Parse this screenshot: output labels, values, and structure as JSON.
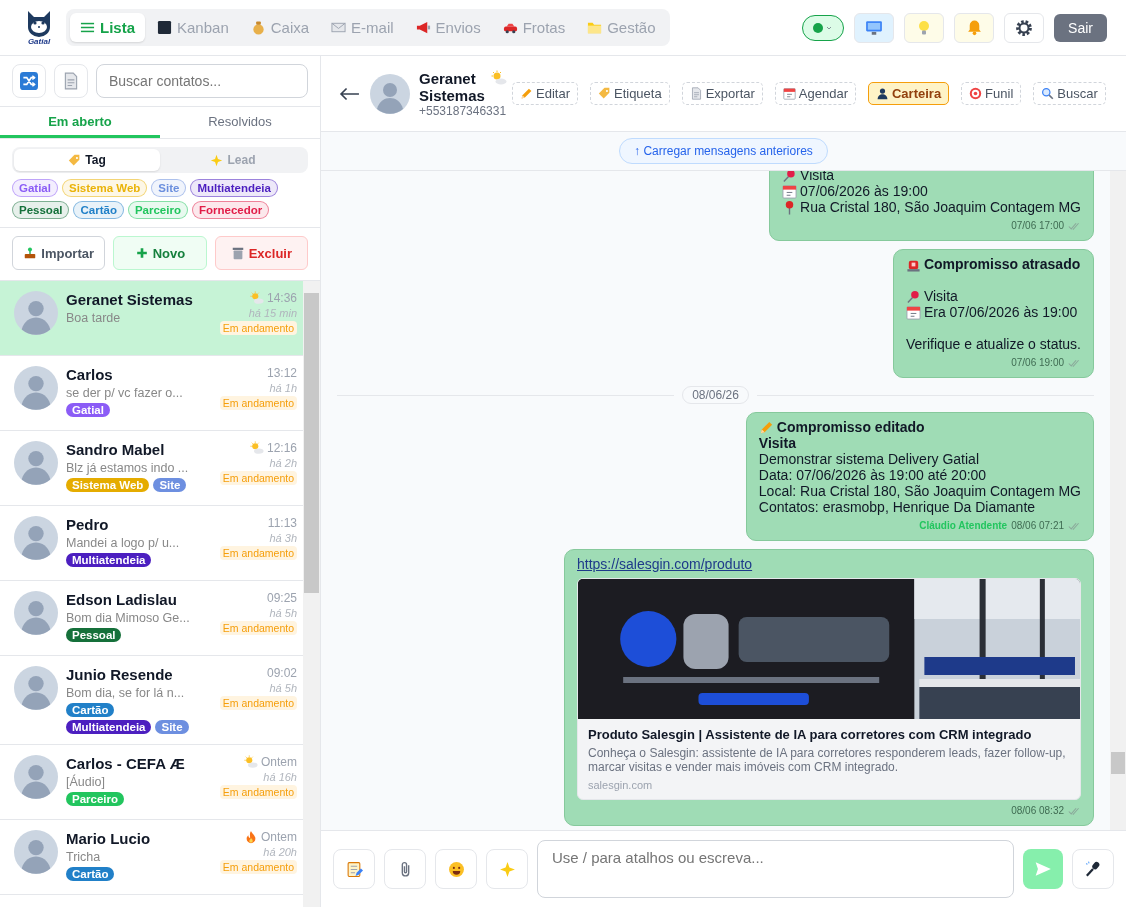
{
  "topbar": {
    "brand": "Gatial",
    "nav": [
      {
        "label": "Lista",
        "selected": true
      },
      {
        "label": "Kanban",
        "selected": false
      },
      {
        "label": "Caixa",
        "selected": false
      },
      {
        "label": "E-mail",
        "selected": false
      },
      {
        "label": "Envios",
        "selected": false
      },
      {
        "label": "Frotas",
        "selected": false
      },
      {
        "label": "Gestão",
        "selected": false
      }
    ],
    "online": true,
    "logout": "Sair"
  },
  "sidebar": {
    "search": {
      "placeholder": "Buscar contatos..."
    },
    "tabs": [
      {
        "label": "Em aberto",
        "selected": true
      },
      {
        "label": "Resolvidos",
        "selected": false
      }
    ],
    "filter_modes": [
      {
        "label": "Tag",
        "selected": true
      },
      {
        "label": "Lead",
        "selected": false
      }
    ],
    "filter_tags": [
      {
        "label": "Gatial",
        "color": "#8b5cf6"
      },
      {
        "label": "Sistema Web",
        "color": "#eab308"
      },
      {
        "label": "Site",
        "color": "#6b8fde"
      },
      {
        "label": "Multiatendeia",
        "color": "#4c1fc0"
      },
      {
        "label": "Pessoal",
        "color": "#15703a"
      },
      {
        "label": "Cartão",
        "color": "#2180c8"
      },
      {
        "label": "Parceiro",
        "color": "#22c55e"
      },
      {
        "label": "Fornecedor",
        "color": "#e11d48"
      }
    ],
    "actions": [
      {
        "label": "Importar",
        "kind": "import"
      },
      {
        "label": "Novo",
        "kind": "new"
      },
      {
        "label": "Excluir",
        "kind": "delete"
      }
    ],
    "contacts": [
      {
        "name": "Geranet Sistemas",
        "preview": "Boa tarde",
        "time": "14:36",
        "ago": "há 15 min",
        "status": "Em andamento",
        "kind": "warm",
        "selected": true
      },
      {
        "name": "Carlos",
        "preview": "se der p/ vc fazer o...",
        "time": "13:12",
        "ago": "há 1h",
        "status": "Em andamento",
        "selected": false,
        "tags": [
          {
            "label": "Gatial",
            "color": "#8b5cf6"
          }
        ]
      },
      {
        "name": "Sandro Mabel",
        "preview": "Blz já estamos indo ...",
        "time": "12:16",
        "ago": "há 2h",
        "status": "Em andamento",
        "kind": "warm",
        "selected": false,
        "tags": [
          {
            "label": "Sistema Web",
            "color": "#e5ac00"
          },
          {
            "label": "Site",
            "color": "#6d8fe0"
          }
        ]
      },
      {
        "name": "Pedro",
        "preview": "Mandei a logo p/ u...",
        "time": "11:13",
        "ago": "há 3h",
        "status": "Em andamento",
        "selected": false,
        "tags": [
          {
            "label": "Multiatendeia",
            "color": "#4c1fc0"
          }
        ]
      },
      {
        "name": "Edson Ladislau",
        "preview": "Bom dia Mimoso Ge...",
        "time": "09:25",
        "ago": "há 5h",
        "status": "Em andamento",
        "selected": false,
        "tags": [
          {
            "label": "Pessoal",
            "color": "#15703a"
          }
        ]
      },
      {
        "name": "Junio Resende",
        "preview": "Bom dia, se for lá n...",
        "time": "09:02",
        "ago": "há 5h",
        "status": "Em andamento",
        "selected": false,
        "tags": [
          {
            "label": "Cartão",
            "color": "#2180c8"
          },
          {
            "label": "Multiatendeia",
            "color": "#4c1fc0"
          },
          {
            "label": "Site",
            "color": "#6d8fe0"
          }
        ]
      },
      {
        "name": "Carlos - CEFA Æ",
        "preview": "[Áudio]",
        "time": "Ontem",
        "ago": "há 16h",
        "status": "Em andamento",
        "kind": "warm",
        "selected": false,
        "tags": [
          {
            "label": "Parceiro",
            "color": "#22c55e"
          }
        ]
      },
      {
        "name": "Mario Lucio",
        "preview": "Tricha",
        "time": "Ontem",
        "ago": "há 20h",
        "status": "Em andamento",
        "kind": "hot",
        "selected": false,
        "tags": [
          {
            "label": "Cartão",
            "color": "#2180c8"
          }
        ]
      }
    ]
  },
  "chat": {
    "contact": {
      "name": "Geranet Sistemas",
      "phone": "+553187346331",
      "kind": "warm"
    },
    "actions": [
      {
        "label": "Editar",
        "selected": false
      },
      {
        "label": "Etiqueta",
        "selected": false
      },
      {
        "label": "Exportar",
        "selected": false
      },
      {
        "label": "Agendar",
        "selected": false
      },
      {
        "label": "Carteira",
        "selected": true
      },
      {
        "label": "Funil",
        "selected": false
      },
      {
        "label": "Buscar",
        "selected": false
      }
    ],
    "load_more": "↑ Carregar mensagens anteriores",
    "messages": [
      {
        "kind": "message",
        "lines": [
          {
            "kind": "visit",
            "text": "Visita"
          },
          {
            "kind": "date",
            "text": "07/06/2026 às 19:00"
          },
          {
            "kind": "place",
            "text": "Rua Cristal 180, São Joaquim Contagem MG"
          }
        ],
        "time": "07/06 17:00",
        "read": true
      },
      {
        "kind": "message",
        "lines": [
          {
            "kind": "alert",
            "text": "Compromisso atrasado"
          },
          {
            "kind": "gap"
          },
          {
            "kind": "visit",
            "text": "Visita"
          },
          {
            "kind": "date",
            "text": "Era 07/06/2026 às 19:00"
          },
          {
            "kind": "gap"
          },
          {
            "kind": "text",
            "text": "Verifique e atualize o status."
          }
        ],
        "time": "07/06 19:00",
        "read": true
      },
      {
        "kind": "date_divider",
        "label": "08/06/26"
      },
      {
        "kind": "message",
        "lines": [
          {
            "kind": "edit",
            "text": "Compromisso editado"
          },
          {
            "kind": "heading",
            "text": "Visita"
          },
          {
            "kind": "text",
            "text": "Demonstrar sistema Delivery Gatial"
          },
          {
            "kind": "text",
            "text": "Data: 07/06/2026 às 19:00 até 20:00"
          },
          {
            "kind": "text",
            "text": "Local: Rua Cristal 180, São Joaquim Contagem MG"
          },
          {
            "kind": "text",
            "text": "Contatos: erasmobp, Henrique Da Diamante"
          }
        ],
        "sender": "Cláudio Atendente",
        "time": "08/06 07:21",
        "read": true
      },
      {
        "kind": "message",
        "link": "https://salesgin.com/produto",
        "preview": {
          "kind": "picture",
          "title": "Produto Salesgin | Assistente de IA para corretores com CRM integrado",
          "description": "Conheça o Salesgin: assistente de IA para corretores responderem leads, fazer follow-up, marcar visitas e vender mais imóveis com CRM integrado.",
          "domain": "salesgin.com"
        },
        "time": "08/06 08:32",
        "read": true
      }
    ],
    "composer": {
      "placeholder": "Use / para atalhos ou escreva..."
    }
  }
}
